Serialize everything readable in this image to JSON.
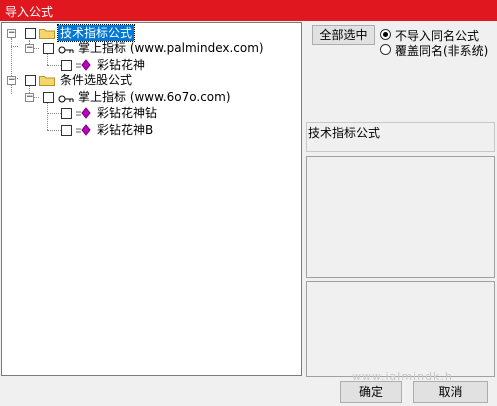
{
  "window": {
    "title": "导入公式"
  },
  "tree": {
    "root1": {
      "label": "技术指标公式"
    },
    "root1_child": {
      "label": "掌上指标 (www.palmindex.com)"
    },
    "root1_leaf": {
      "label": "彩钻花神"
    },
    "root2": {
      "label": "条件选股公式"
    },
    "root2_child": {
      "label": "掌上指标 (www.6o7o.com)"
    },
    "root2_leaf1": {
      "label": "彩钻花神钻"
    },
    "root2_leaf2": {
      "label": "彩钻花神B"
    }
  },
  "right": {
    "select_all_label": "全部选中",
    "radio_skip_label": "不导入同名公式",
    "radio_overwrite_label": "覆盖同名(非系统)",
    "info_label": "技术指标公式"
  },
  "footer": {
    "ok_label": "确定",
    "cancel_label": "取消",
    "watermark": "www.ialmindk.h"
  },
  "colors": {
    "title_bg": "#e0171f",
    "selection": "#0078d7"
  },
  "icons": {
    "folder": "folder-icon",
    "key": "key-icon",
    "formula": "formula-gem-icon"
  }
}
